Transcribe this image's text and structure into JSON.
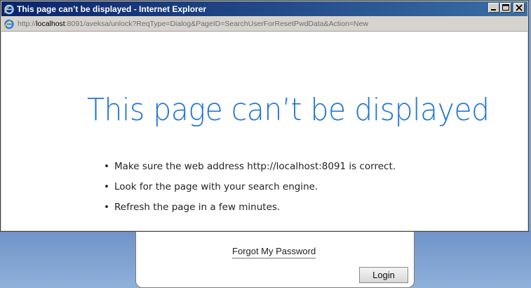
{
  "window": {
    "title": "This page can’t be displayed - Internet Explorer",
    "icon": "ie-icon",
    "controls": [
      "minimize-icon",
      "maximize-icon",
      "close-icon"
    ]
  },
  "address": {
    "scheme": "http://",
    "host": "localhost",
    "rest": ":8091/aveksa/unlock?ReqType=Dialog&PageID=SearchUserForResetPwdData&Action=New"
  },
  "error": {
    "heading": "This page can’t be displayed",
    "tips": [
      "Make sure the web address http://localhost:8091 is correct.",
      "Look for the page with your search engine.",
      "Refresh the page in a few minutes."
    ]
  },
  "login_panel": {
    "forgot_label": "Forgot My Password",
    "login_label": "Login"
  },
  "colors": {
    "heading": "#1f74d6",
    "title_bar_start": "#0a246a",
    "title_bar_end": "#3a6ea5",
    "desktop": "#7f9fc9"
  }
}
